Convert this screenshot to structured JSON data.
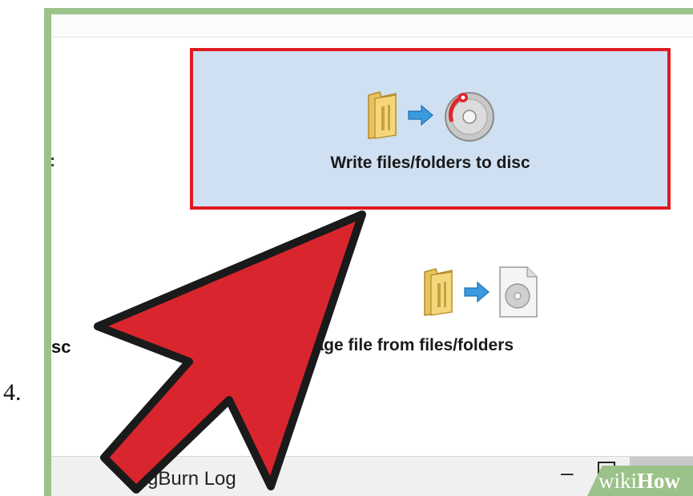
{
  "step_number": "4.",
  "window": {
    "left_cut_label": "sc",
    "left_dot": ":",
    "tiles": {
      "write": {
        "label": "Write files/folders to disc",
        "highlight_color": "#e01a22",
        "background": "#cfe0f2"
      },
      "image": {
        "label": "image file from files/folders"
      }
    },
    "status_bar": {
      "log_label": "gBurn Log",
      "minimize": "–",
      "close": "×"
    }
  },
  "arrow_color": "#d9262e",
  "watermark": {
    "part1": "wiki",
    "part2": "How",
    "background": "#9bc289"
  }
}
